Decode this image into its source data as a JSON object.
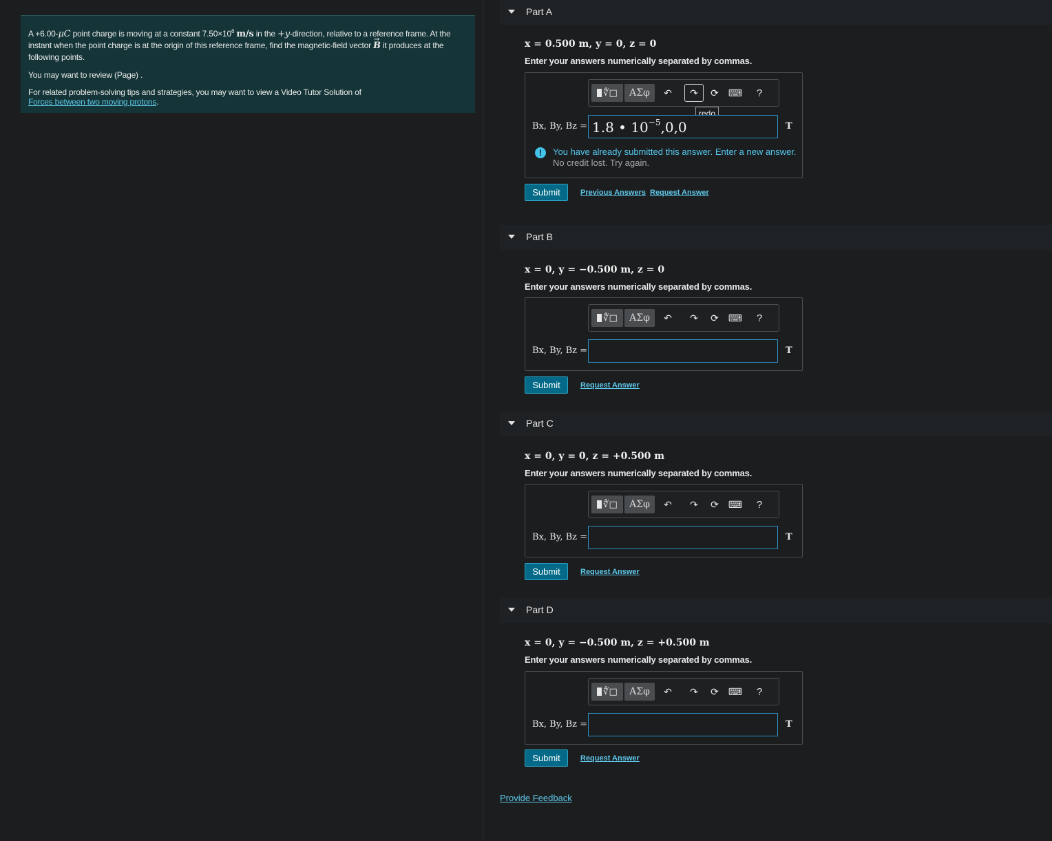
{
  "intro": {
    "line1_prefix": "A +6.00-",
    "charge_unit": "μC",
    "line1_mid": " point charge is moving at a constant 7.50×10",
    "speed_exp": "6",
    "speed_unit": "m/s",
    "line1_mid2": " in the ",
    "direction": "+y",
    "line1_suffix": "-direction, relative to a reference frame. At the instant when the point charge is at the origin of this reference frame, find the magnetic-field vector ",
    "vector": "B",
    "line1_end": " it produces at the following points.",
    "review_text": "You may want to review (Page) .",
    "tips_text": "For related problem-solving tips and strategies, you may want to view a Video Tutor Solution of",
    "tips_link": "Forces between two moving protons",
    "tips_end": "."
  },
  "toolbar": {
    "greek_label": "ΑΣφ",
    "help_label": "?",
    "redo_tooltip": "redo"
  },
  "parts": [
    {
      "title": "Part A",
      "coords": "x = 0.500 m,  y = 0, z = 0",
      "instruction": "Enter your answers numerically separated by commas.",
      "label": "Bx, By, Bz =",
      "answer_base": "1.8 • 10",
      "answer_exp": "−5",
      "answer_rest": ",0,0",
      "unit": "T",
      "feedback": "You have already submitted this answer. Enter a new answer.",
      "feedback_sub": "No credit lost. Try again.",
      "submit": "Submit",
      "previous_answers": "Previous Answers",
      "request_answer": "Request Answer"
    },
    {
      "title": "Part B",
      "coords": "x = 0, y = −0.500 m, z = 0",
      "instruction": "Enter your answers numerically separated by commas.",
      "label": "Bx, By, Bz =",
      "unit": "T",
      "submit": "Submit",
      "request_answer": "Request Answer"
    },
    {
      "title": "Part C",
      "coords": "x = 0, y = 0, z = +0.500 m",
      "instruction": "Enter your answers numerically separated by commas.",
      "label": "Bx, By, Bz =",
      "unit": "T",
      "submit": "Submit",
      "request_answer": "Request Answer"
    },
    {
      "title": "Part D",
      "coords": "x = 0, y = −0.500 m, z = +0.500 m",
      "instruction": "Enter your answers numerically separated by commas.",
      "label": "Bx, By, Bz =",
      "unit": "T",
      "submit": "Submit",
      "request_answer": "Request Answer"
    }
  ],
  "provide_feedback": "Provide Feedback",
  "colors": {
    "accent_link": "#5fc8ea",
    "submit_bg": "#046a87",
    "intro_bg": "#143437"
  },
  "icons": [
    "template-icon",
    "greek-symbols-icon",
    "undo-icon",
    "redo-icon",
    "reset-icon",
    "keyboard-icon",
    "help-icon",
    "collapse-triangle-icon",
    "info-icon"
  ]
}
